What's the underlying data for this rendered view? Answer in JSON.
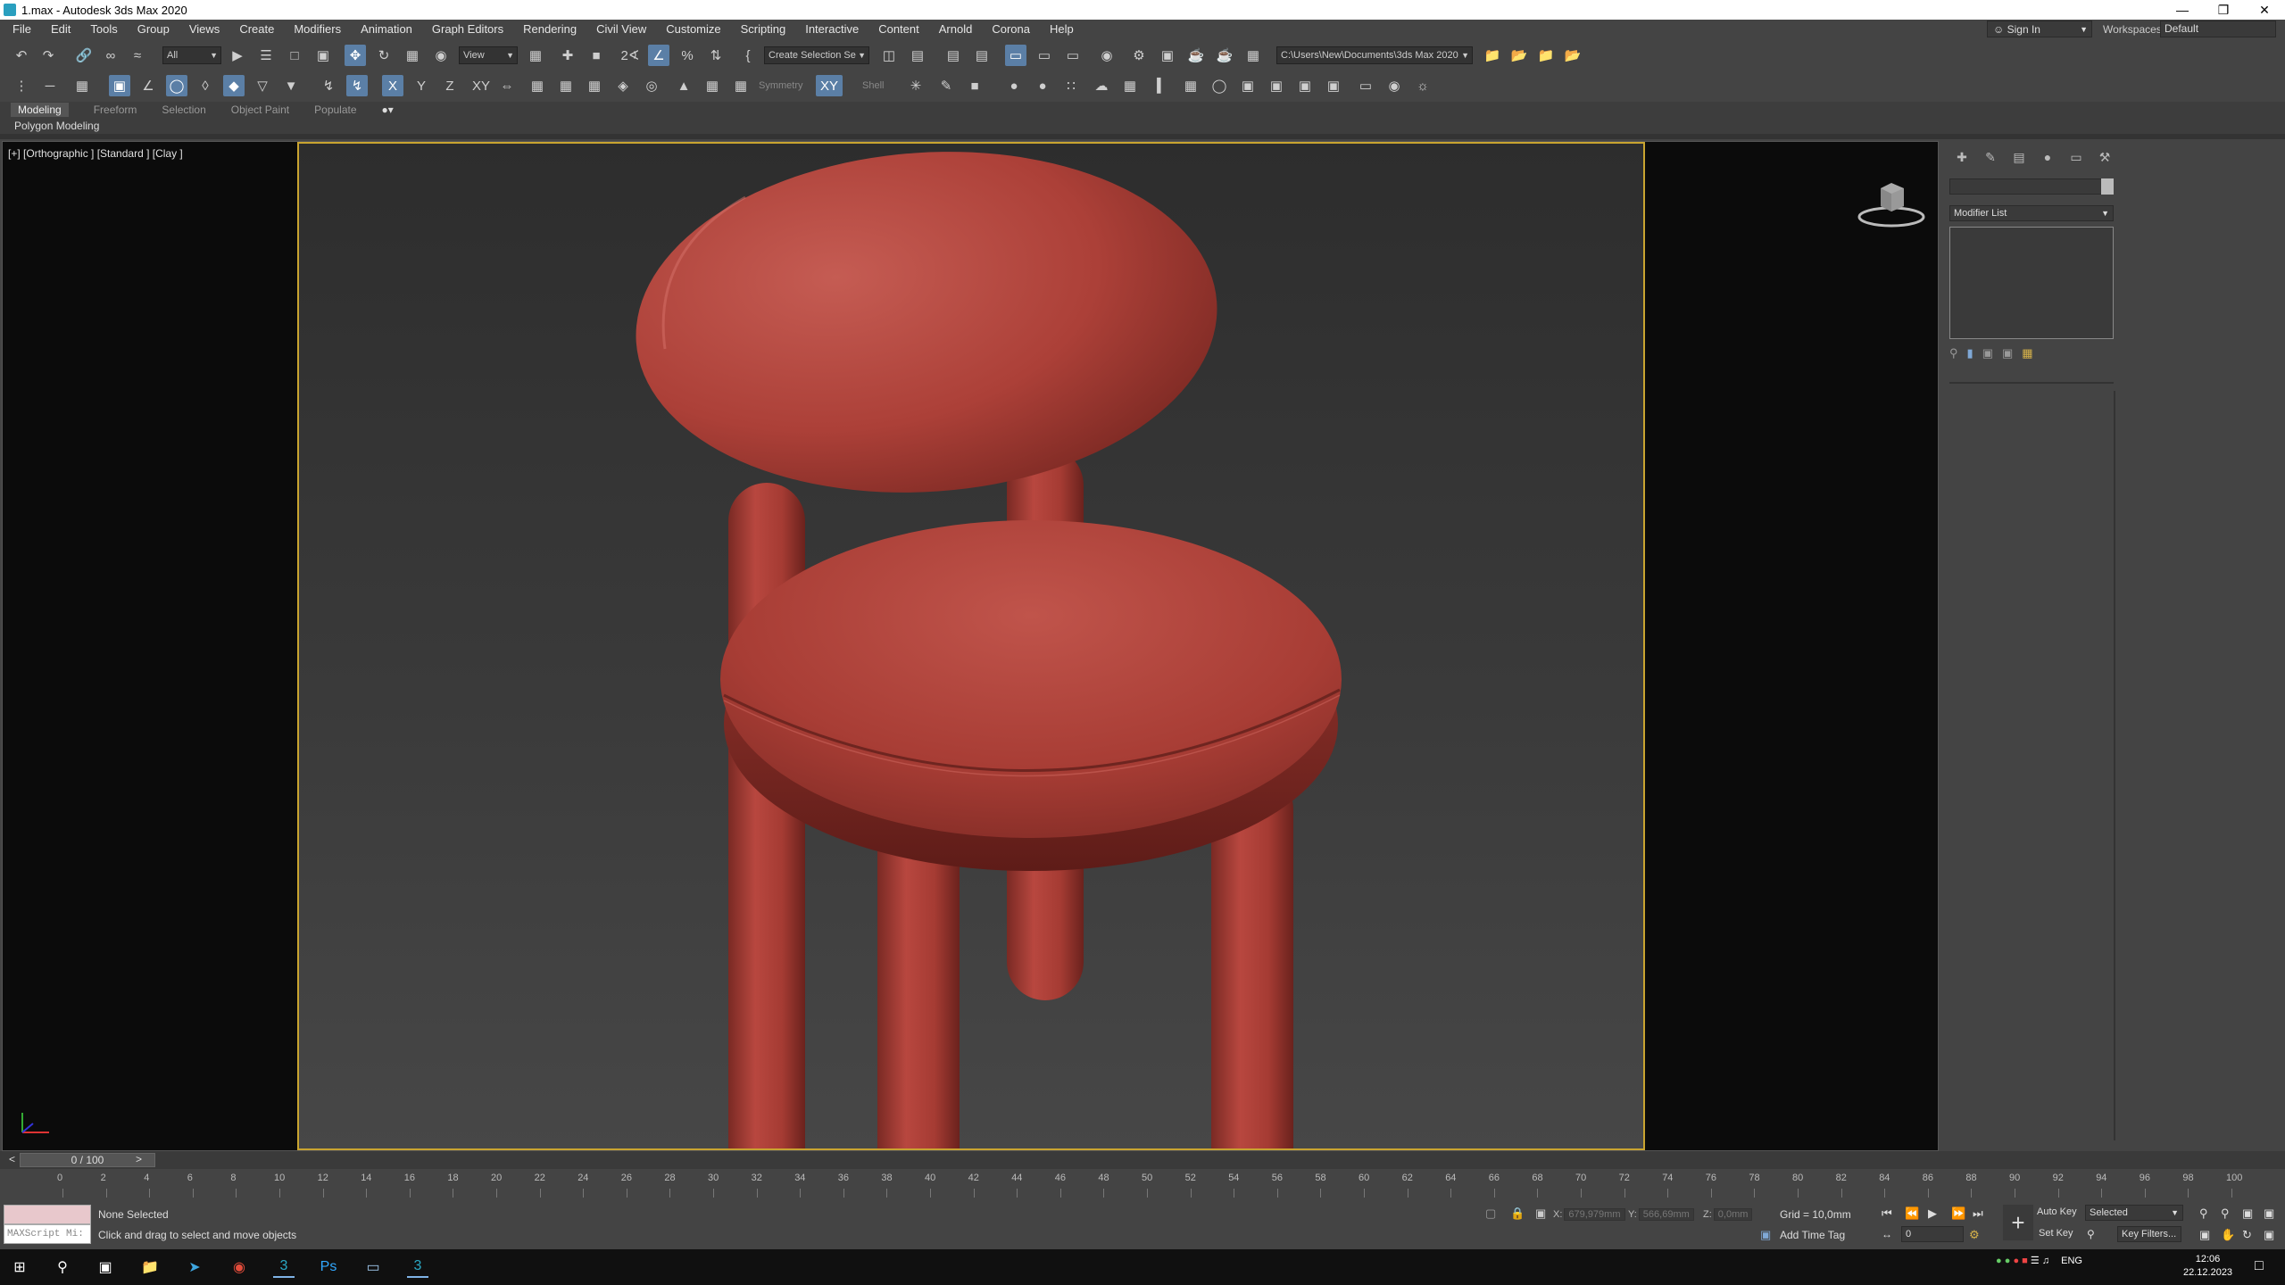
{
  "window": {
    "title": "1.max - Autodesk 3ds Max 2020",
    "controls": [
      "—",
      "❐",
      "✕"
    ]
  },
  "menu": [
    "File",
    "Edit",
    "Tools",
    "Group",
    "Views",
    "Create",
    "Modifiers",
    "Animation",
    "Graph Editors",
    "Rendering",
    "Civil View",
    "Customize",
    "Scripting",
    "Interactive",
    "Content",
    "Arnold",
    "Corona",
    "Help"
  ],
  "account": {
    "sign_in": "Sign In",
    "workspaces_label": "Workspaces:",
    "workspace": "Default"
  },
  "toolbar": {
    "filter": "All",
    "ref_coord": "View",
    "selection_set": "Create Selection Se",
    "project_path": "C:\\Users\\New\\Documents\\3ds Max 2020"
  },
  "toolbar2": {
    "symmetry": "Symmetry",
    "shell": "Shell",
    "axis_x": "X",
    "axis_y": "Y",
    "axis_z": "Z",
    "axis_xy": "XY"
  },
  "ribbon": {
    "tabs": [
      "Modeling",
      "Freeform",
      "Selection",
      "Object Paint",
      "Populate"
    ],
    "panel": "Polygon Modeling"
  },
  "viewport": {
    "label": "[+] [Orthographic ] [Standard ] [Clay ]"
  },
  "command_panel": {
    "modifier_list": "Modifier List"
  },
  "timeline": {
    "slider": "0 / 100",
    "ticks": [
      "0",
      "2",
      "4",
      "6",
      "8",
      "10",
      "12",
      "14",
      "16",
      "18",
      "20",
      "22",
      "24",
      "26",
      "28",
      "30",
      "32",
      "34",
      "36",
      "38",
      "40",
      "42",
      "44",
      "46",
      "48",
      "50",
      "52",
      "54",
      "56",
      "58",
      "60",
      "62",
      "64",
      "66",
      "68",
      "70",
      "72",
      "74",
      "76",
      "78",
      "80",
      "82",
      "84",
      "86",
      "88",
      "90",
      "92",
      "94",
      "96",
      "98",
      "100"
    ]
  },
  "status": {
    "maxscript": "MAXScript Mi:",
    "selection": "None Selected",
    "prompt": "Click and drag to select and move objects",
    "x_label": "X:",
    "x_val": "679,979mm",
    "y_label": "Y:",
    "y_val": "566,69mm",
    "z_label": "Z:",
    "z_val": "0,0mm",
    "grid": "Grid = 10,0mm",
    "add_time_tag": "Add Time Tag",
    "auto_key": "Auto Key",
    "selected": "Selected",
    "set_key": "Set Key",
    "key_filters": "Key Filters...",
    "frame": "0"
  },
  "taskbar": {
    "lang": "ENG",
    "time": "12:06",
    "date": "22.12.2023"
  },
  "colors": {
    "chair": "#b5443c",
    "safe_frame": "#c9a430",
    "active_button": "#5b7fa6"
  }
}
